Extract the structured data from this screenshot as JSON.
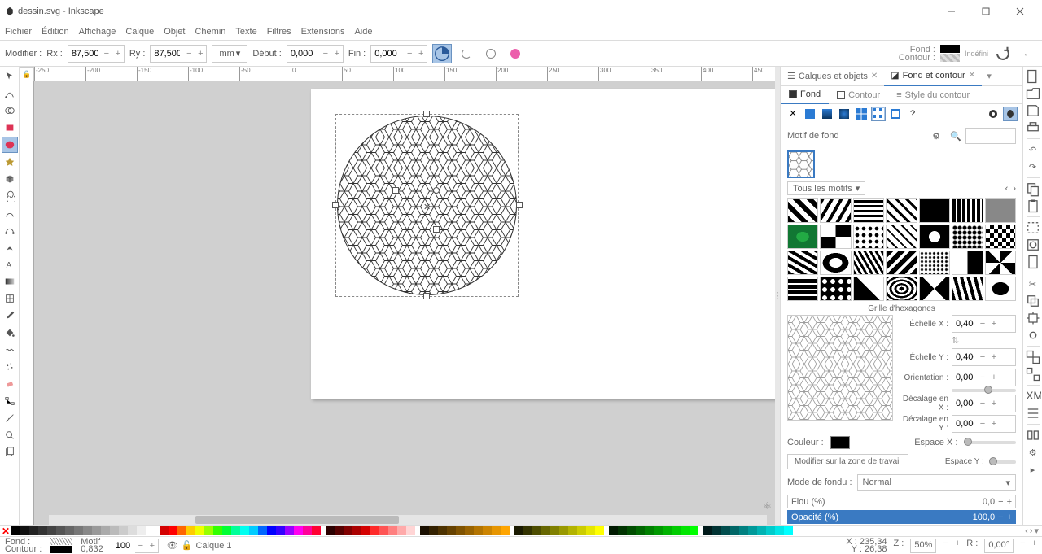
{
  "window": {
    "title": "dessin.svg - Inkscape"
  },
  "menu": [
    "Fichier",
    "Édition",
    "Affichage",
    "Calque",
    "Objet",
    "Chemin",
    "Texte",
    "Filtres",
    "Extensions",
    "Aide"
  ],
  "toolopts": {
    "modifier": "Modifier :",
    "rx_label": "Rx :",
    "rx": "87,500",
    "ry_label": "Ry :",
    "ry": "87,500",
    "unit": "mm",
    "debut_label": "Début :",
    "debut": "0,000",
    "fin_label": "Fin :",
    "fin": "0,000",
    "fond_label": "Fond :",
    "contour_label": "Contour :",
    "indefini": "Indéfini"
  },
  "ruler_ticks": [
    "-250",
    "-200",
    "-150",
    "-100",
    "-50",
    "0",
    "50",
    "100",
    "150",
    "200",
    "250",
    "300",
    "350",
    "400",
    "450"
  ],
  "dock": {
    "tab1": "Calques et objets",
    "tab2": "Fond et contour",
    "sub_fond": "Fond",
    "sub_contour": "Contour",
    "sub_style": "Style du contour",
    "motif_head": "Motif de fond",
    "pattern_cat": "Tous les motifs",
    "pattern_name": "Grille d'hexagones",
    "scale_x_lbl": "Échelle X :",
    "scale_x": "0,400",
    "scale_y_lbl": "Échelle Y :",
    "scale_y": "0,400",
    "orient_lbl": "Orientation :",
    "orient": "0,00",
    "offx_lbl": "Décalage en X :",
    "offx": "0,000",
    "offy_lbl": "Décalage en Y :",
    "offy": "0,000",
    "color_lbl": "Couleur :",
    "spacex_lbl": "Espace X :",
    "spacey_lbl": "Espace Y :",
    "btn_editoncanvas": "Modifier sur la zone de travail",
    "blend_lbl": "Mode de fondu :",
    "blend_val": "Normal",
    "blur_lbl": "Flou (%)",
    "blur": "0,0",
    "opacity_lbl": "Opacité (%)",
    "opacity": "100,0"
  },
  "status": {
    "fond": "Fond :",
    "fond_val": "Motif",
    "contour": "Contour :",
    "contour_val": "0,832",
    "opacity": "100",
    "layer": "Calque 1",
    "x_lbl": "X :",
    "x": "235,34",
    "y_lbl": "Y :",
    "y": "26,38",
    "z_lbl": "Z :",
    "zoom": "50%",
    "r_lbl": "R :",
    "rot": "0,00°"
  },
  "palette_grays": [
    "#000",
    "#111",
    "#222",
    "#333",
    "#444",
    "#555",
    "#666",
    "#777",
    "#888",
    "#999",
    "#aaa",
    "#bbb",
    "#ccc",
    "#ddd",
    "#eee",
    "#fff"
  ],
  "palette_hues": [
    "#d40000",
    "#ff0000",
    "#ff6600",
    "#ffcc00",
    "#f0ff00",
    "#99ff00",
    "#33ff00",
    "#00ff33",
    "#00ff99",
    "#00fff0",
    "#00ccff",
    "#0066ff",
    "#0000ff",
    "#3300ff",
    "#9900ff",
    "#ff00f0",
    "#ff0099",
    "#ff0033"
  ],
  "palette_reds": [
    "#2b0000",
    "#550000",
    "#800000",
    "#aa0000",
    "#d40000",
    "#ff2a2a",
    "#ff5555",
    "#ff8080",
    "#ffaaaa",
    "#ffd5d5"
  ],
  "palette_row3": [
    "#1a0f00",
    "#332100",
    "#4d3200",
    "#664200",
    "#805300",
    "#996300",
    "#b37400",
    "#cc8400",
    "#e69500",
    "#ffa500"
  ],
  "palette_row4": [
    "#1a1a00",
    "#333300",
    "#4d4d00",
    "#666600",
    "#808000",
    "#999900",
    "#b3b300",
    "#cccc00",
    "#e6e600",
    "#ffff00"
  ],
  "palette_row5": [
    "#001a00",
    "#003300",
    "#004d00",
    "#006600",
    "#008000",
    "#009900",
    "#00b300",
    "#00cc00",
    "#00e600",
    "#00ff00"
  ],
  "palette_row6": [
    "#001a1a",
    "#003333",
    "#004d4d",
    "#006666",
    "#008080",
    "#009999",
    "#00b3b3",
    "#00cccc",
    "#00e6e6",
    "#00ffff"
  ]
}
